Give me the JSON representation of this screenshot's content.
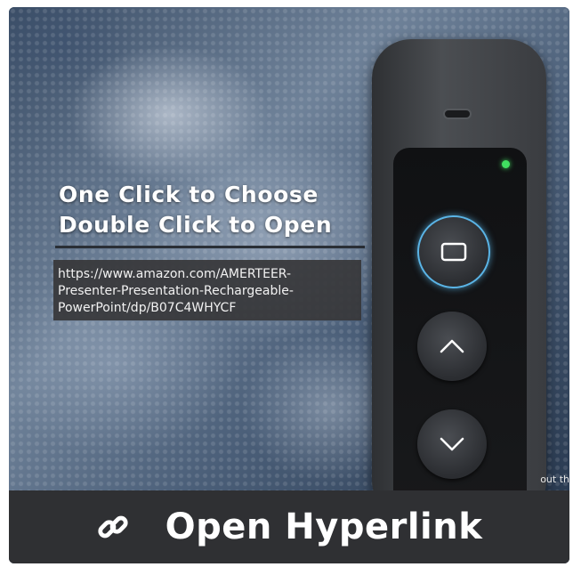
{
  "overlay": {
    "heading_line1": "One Click to Choose",
    "heading_line2": "Double Click to Open",
    "url_lines": [
      "https://www.amazon.com/AMERTEER-",
      "Presenter-Presentation-Rechargeable-",
      "PowerPoint/dp/B07C4WHYCF"
    ]
  },
  "background_edge_text": "out th",
  "action_bar": {
    "icon": "link-icon",
    "label": "Open Hyperlink"
  },
  "colors": {
    "bar": "#2f3033",
    "url_box": "#37373a",
    "led": "#40e060",
    "select_ring": "#5ab4e6"
  }
}
